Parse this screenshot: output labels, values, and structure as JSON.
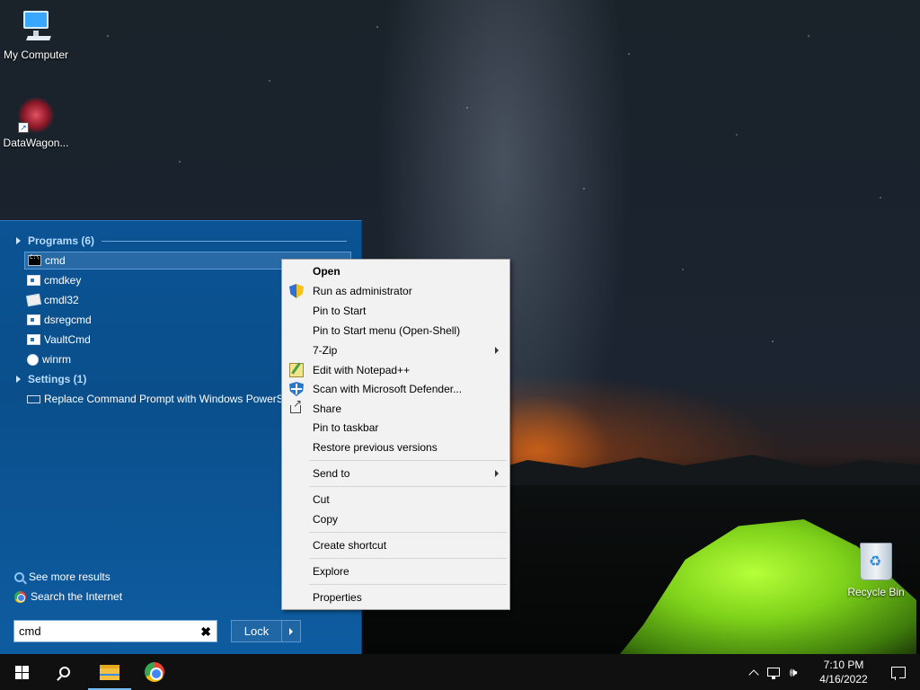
{
  "desktop": {
    "icons": [
      {
        "label": "My Computer",
        "icon": "computer-icon"
      },
      {
        "label": "DataWagon...",
        "icon": "datawagon-icon"
      },
      {
        "label": "Recycle Bin",
        "icon": "recycle-bin-icon"
      }
    ]
  },
  "start_menu": {
    "programs_header": "Programs (6)",
    "programs": [
      {
        "label": "cmd",
        "icon": "console-icon",
        "selected": true
      },
      {
        "label": "cmdkey",
        "icon": "window-icon"
      },
      {
        "label": "cmdl32",
        "icon": "cmdl32-icon"
      },
      {
        "label": "dsregcmd",
        "icon": "window-icon"
      },
      {
        "label": "VaultCmd",
        "icon": "window-icon"
      },
      {
        "label": "winrm",
        "icon": "gear-icon"
      }
    ],
    "settings_header": "Settings (1)",
    "settings": [
      {
        "label": "Replace Command Prompt with Windows PowerShell",
        "icon": "monitor-icon"
      }
    ],
    "see_more": "See more results",
    "search_internet": "Search the Internet",
    "search_value": "cmd",
    "lock_label": "Lock"
  },
  "context_menu": {
    "items": [
      {
        "label": "Open",
        "bold": true
      },
      {
        "label": "Run as administrator",
        "icon": "uac-shield-icon"
      },
      {
        "label": "Pin to Start"
      },
      {
        "label": "Pin to Start menu (Open-Shell)"
      },
      {
        "label": "7-Zip",
        "submenu": true
      },
      {
        "label": "Edit with Notepad++",
        "icon": "notepad-plus-plus-icon"
      },
      {
        "label": "Scan with Microsoft Defender...",
        "icon": "defender-icon"
      },
      {
        "label": "Share",
        "icon": "share-icon"
      },
      {
        "label": "Pin to taskbar"
      },
      {
        "label": "Restore previous versions"
      },
      {
        "label": "Send to",
        "submenu": true
      },
      {
        "label": "Cut"
      },
      {
        "label": "Copy"
      },
      {
        "label": "Create shortcut"
      },
      {
        "label": "Explore"
      },
      {
        "label": "Properties"
      }
    ]
  },
  "taskbar": {
    "time": "7:10 PM",
    "date": "4/16/2022",
    "pinned": [
      "start-button",
      "search-button",
      "file-explorer",
      "chrome"
    ],
    "tray_icons": [
      "chevron-up-icon",
      "network-icon",
      "volume-icon",
      "notification-icon"
    ]
  },
  "colors": {
    "start_menu_bg": "#0b5394",
    "taskbar_bg": "#101010",
    "context_menu_bg": "#f2f2f2"
  }
}
